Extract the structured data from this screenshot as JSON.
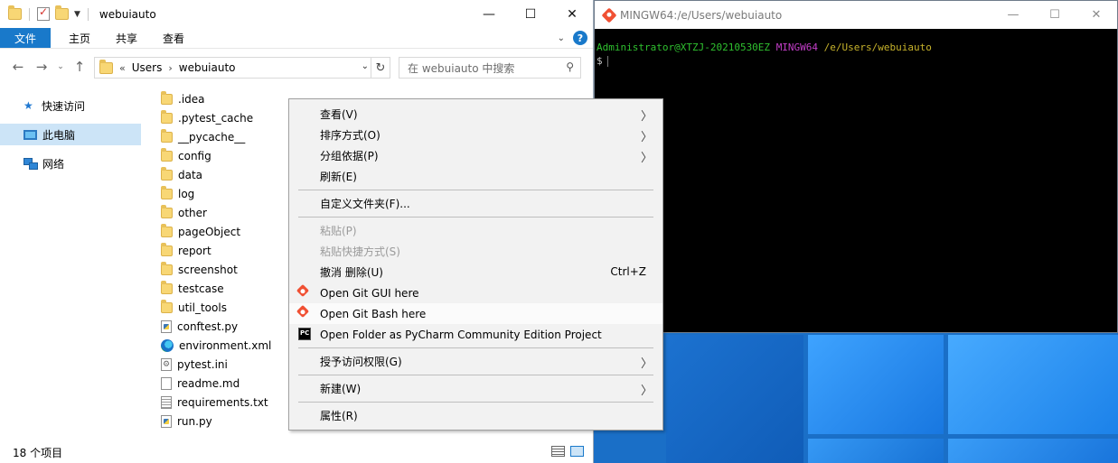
{
  "explorer": {
    "window_title": "webuiauto",
    "ribbon_tabs": [
      "文件",
      "主页",
      "共享",
      "查看"
    ],
    "breadcrumb": {
      "overflow": "«",
      "items": [
        "Users",
        "webuiauto"
      ]
    },
    "search_placeholder": "在 webuiauto 中搜索",
    "nav_pane": [
      {
        "label": "快速访问",
        "icon": "quick-access-star-icon"
      },
      {
        "label": "此电脑",
        "icon": "this-pc-icon",
        "selected": true
      },
      {
        "label": "网络",
        "icon": "network-icon"
      }
    ],
    "files": [
      {
        "name": ".idea",
        "type": "folder"
      },
      {
        "name": ".pytest_cache",
        "type": "folder"
      },
      {
        "name": "__pycache__",
        "type": "folder"
      },
      {
        "name": "config",
        "type": "folder"
      },
      {
        "name": "data",
        "type": "folder"
      },
      {
        "name": "log",
        "type": "folder"
      },
      {
        "name": "other",
        "type": "folder"
      },
      {
        "name": "pageObject",
        "type": "folder"
      },
      {
        "name": "report",
        "type": "folder"
      },
      {
        "name": "screenshot",
        "type": "folder"
      },
      {
        "name": "testcase",
        "type": "folder"
      },
      {
        "name": "util_tools",
        "type": "folder"
      },
      {
        "name": "conftest.py",
        "type": "py"
      },
      {
        "name": "environment.xml",
        "type": "xml"
      },
      {
        "name": "pytest.ini",
        "type": "ini"
      },
      {
        "name": "readme.md",
        "type": "md"
      },
      {
        "name": "requirements.txt",
        "type": "txt"
      },
      {
        "name": "run.py",
        "type": "py"
      }
    ],
    "status": "18 个项目"
  },
  "terminal": {
    "title": "MINGW64:/e/Users/webuiauto",
    "prompt_user": "Administrator@XTZJ-20210530EZ",
    "prompt_env": "MINGW64",
    "prompt_path": "/e/Users/webuiauto",
    "prompt_symbol": "$"
  },
  "context_menu": {
    "items": [
      {
        "label": "查看(V)",
        "submenu": true
      },
      {
        "label": "排序方式(O)",
        "submenu": true
      },
      {
        "label": "分组依据(P)",
        "submenu": true
      },
      {
        "label": "刷新(E)"
      },
      {
        "sep": true
      },
      {
        "label": "自定义文件夹(F)..."
      },
      {
        "sep": true
      },
      {
        "label": "粘贴(P)",
        "disabled": true
      },
      {
        "label": "粘贴快捷方式(S)",
        "disabled": true
      },
      {
        "label": "撤消 删除(U)",
        "shortcut": "Ctrl+Z"
      },
      {
        "label": "Open Git GUI here",
        "icon": "git"
      },
      {
        "label": "Open Git Bash here",
        "icon": "git",
        "hover": true
      },
      {
        "label": "Open Folder as PyCharm Community Edition Project",
        "icon": "pycharm",
        "icon_text": "PC"
      },
      {
        "sep": true
      },
      {
        "label": "授予访问权限(G)",
        "submenu": true
      },
      {
        "sep": true
      },
      {
        "label": "新建(W)",
        "submenu": true
      },
      {
        "sep": true
      },
      {
        "label": "属性(R)"
      }
    ]
  }
}
